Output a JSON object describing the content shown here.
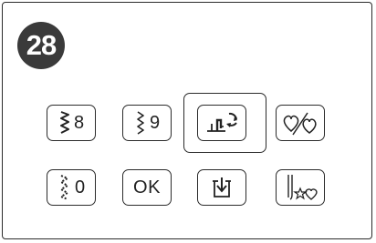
{
  "panel": {
    "step_number": "28"
  },
  "keys": {
    "stitch_8": {
      "label": "8",
      "icon": "zigzag-stitch-icon"
    },
    "stitch_9": {
      "label": "9",
      "icon": "zigzag-stitch-icon"
    },
    "needle_reset": {
      "icon": "presser-foot-rotate-icon",
      "selected": true
    },
    "mirror": {
      "icon": "heart-mirror-icon"
    },
    "stitch_0": {
      "label": "0",
      "icon": "dotted-zigzag-stitch-icon"
    },
    "ok": {
      "label": "OK"
    },
    "memory": {
      "icon": "download-tray-icon"
    },
    "twin_needle": {
      "icon": "needle-star-heart-icon"
    }
  }
}
